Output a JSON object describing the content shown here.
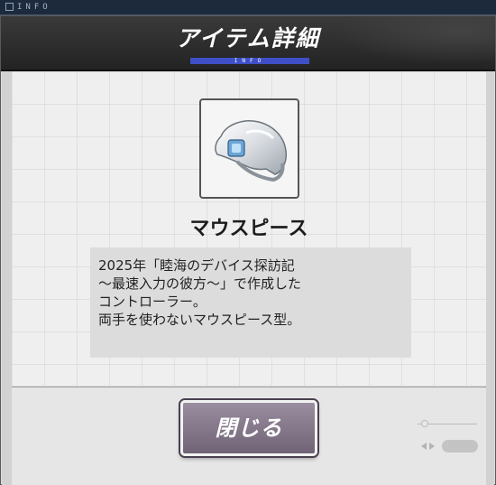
{
  "top_strip": {
    "label": "INFO"
  },
  "dialog": {
    "title": "アイテム詳細",
    "subtitle": "INFO"
  },
  "item": {
    "icon": "mouthpiece-icon",
    "name": "マウスピース",
    "description_lines": [
      "2025年「睦海のデバイス探訪記",
      "～最速入力の彼方～」で作成した",
      "コントローラー。",
      "両手を使わないマウスピース型。"
    ]
  },
  "footer": {
    "close_label": "閉じる"
  },
  "colors": {
    "header_bg": "#2a2a2a",
    "accent_bar": "#3e4fc8",
    "button_bg": "#8a7d90",
    "panel_bg": "#efefef"
  }
}
